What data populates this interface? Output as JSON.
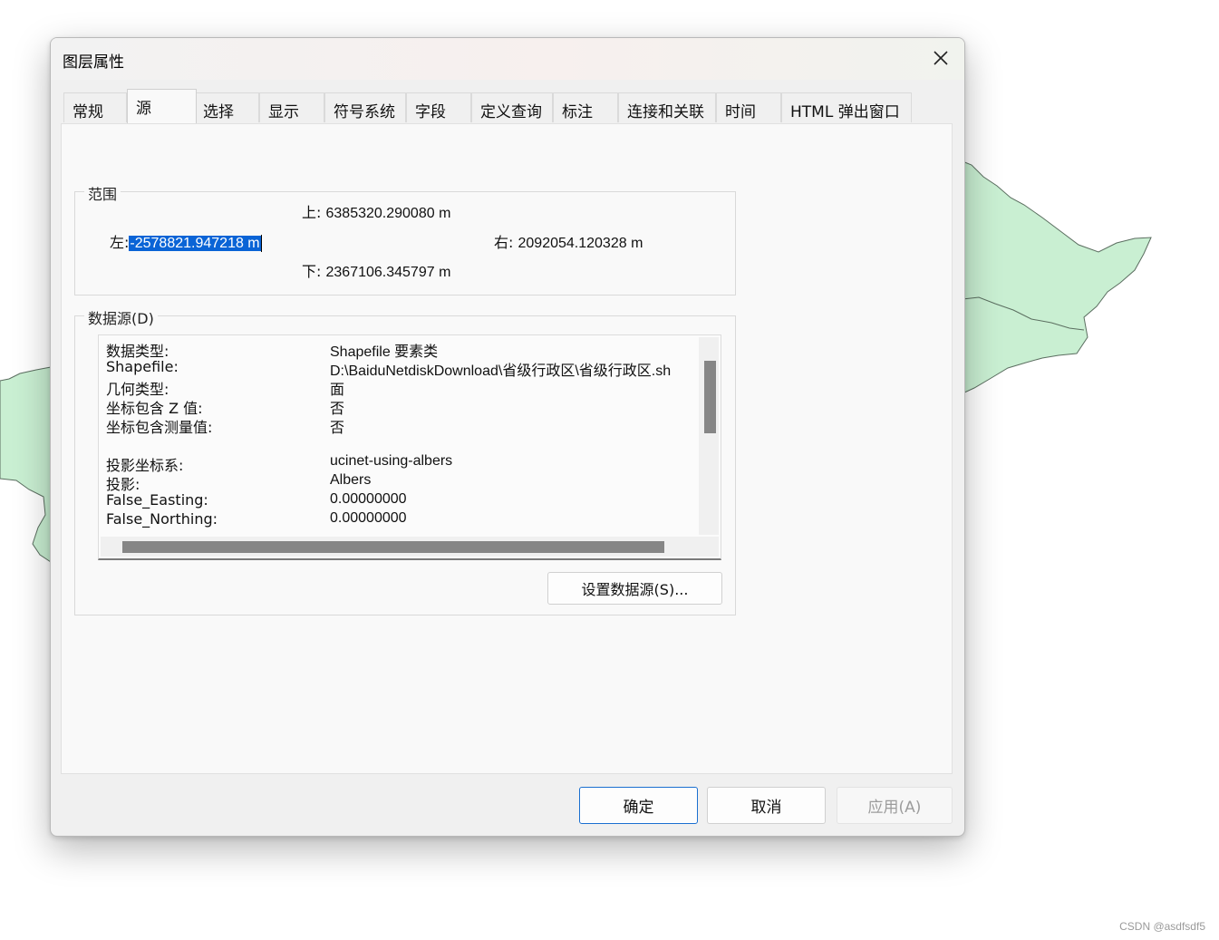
{
  "dialog": {
    "title": "图层属性"
  },
  "tabs": [
    {
      "label": "常规"
    },
    {
      "label": "源"
    },
    {
      "label": "选择"
    },
    {
      "label": "显示"
    },
    {
      "label": "符号系统"
    },
    {
      "label": "字段"
    },
    {
      "label": "定义查询"
    },
    {
      "label": "标注"
    },
    {
      "label": "连接和关联"
    },
    {
      "label": "时间"
    },
    {
      "label": "HTML 弹出窗口"
    }
  ],
  "active_tab": "源",
  "extent": {
    "legend": "范围",
    "top_label": "上:",
    "top_value": "6385320.290080 m",
    "left_label": "左:",
    "left_value": "-2578821.947218 m",
    "right_label": "右:",
    "right_value": "2092054.120328 m",
    "bottom_label": "下:",
    "bottom_value": "2367106.345797 m"
  },
  "datasource": {
    "legend": "数据源(D)",
    "rows": [
      {
        "key": "数据类型:",
        "value": "Shapefile 要素类"
      },
      {
        "key": "Shapefile:",
        "value": "D:\\BaiduNetdiskDownload\\省级行政区\\省级行政区.sh"
      },
      {
        "key": "几何类型:",
        "value": "面"
      },
      {
        "key": "坐标包含 Z 值:",
        "value": "否"
      },
      {
        "key": "坐标包含测量值:",
        "value": "否"
      },
      {
        "key": "",
        "value": ""
      },
      {
        "key": "投影坐标系:",
        "value": "ucinet-using-albers"
      },
      {
        "key": "投影:",
        "value": "Albers"
      },
      {
        "key": "False_Easting:",
        "value": "0.00000000"
      },
      {
        "key": "False_Northing:",
        "value": "0.00000000"
      }
    ],
    "set_source_button": "设置数据源(S)..."
  },
  "buttons": {
    "ok": "确定",
    "cancel": "取消",
    "apply": "应用(A)"
  },
  "watermark": "CSDN @asdfsdf5",
  "colors": {
    "map_fill": "#c9efd2",
    "map_stroke": "#5b6e60",
    "selection": "#0a64d6",
    "primary_border": "#1a6fd0"
  }
}
